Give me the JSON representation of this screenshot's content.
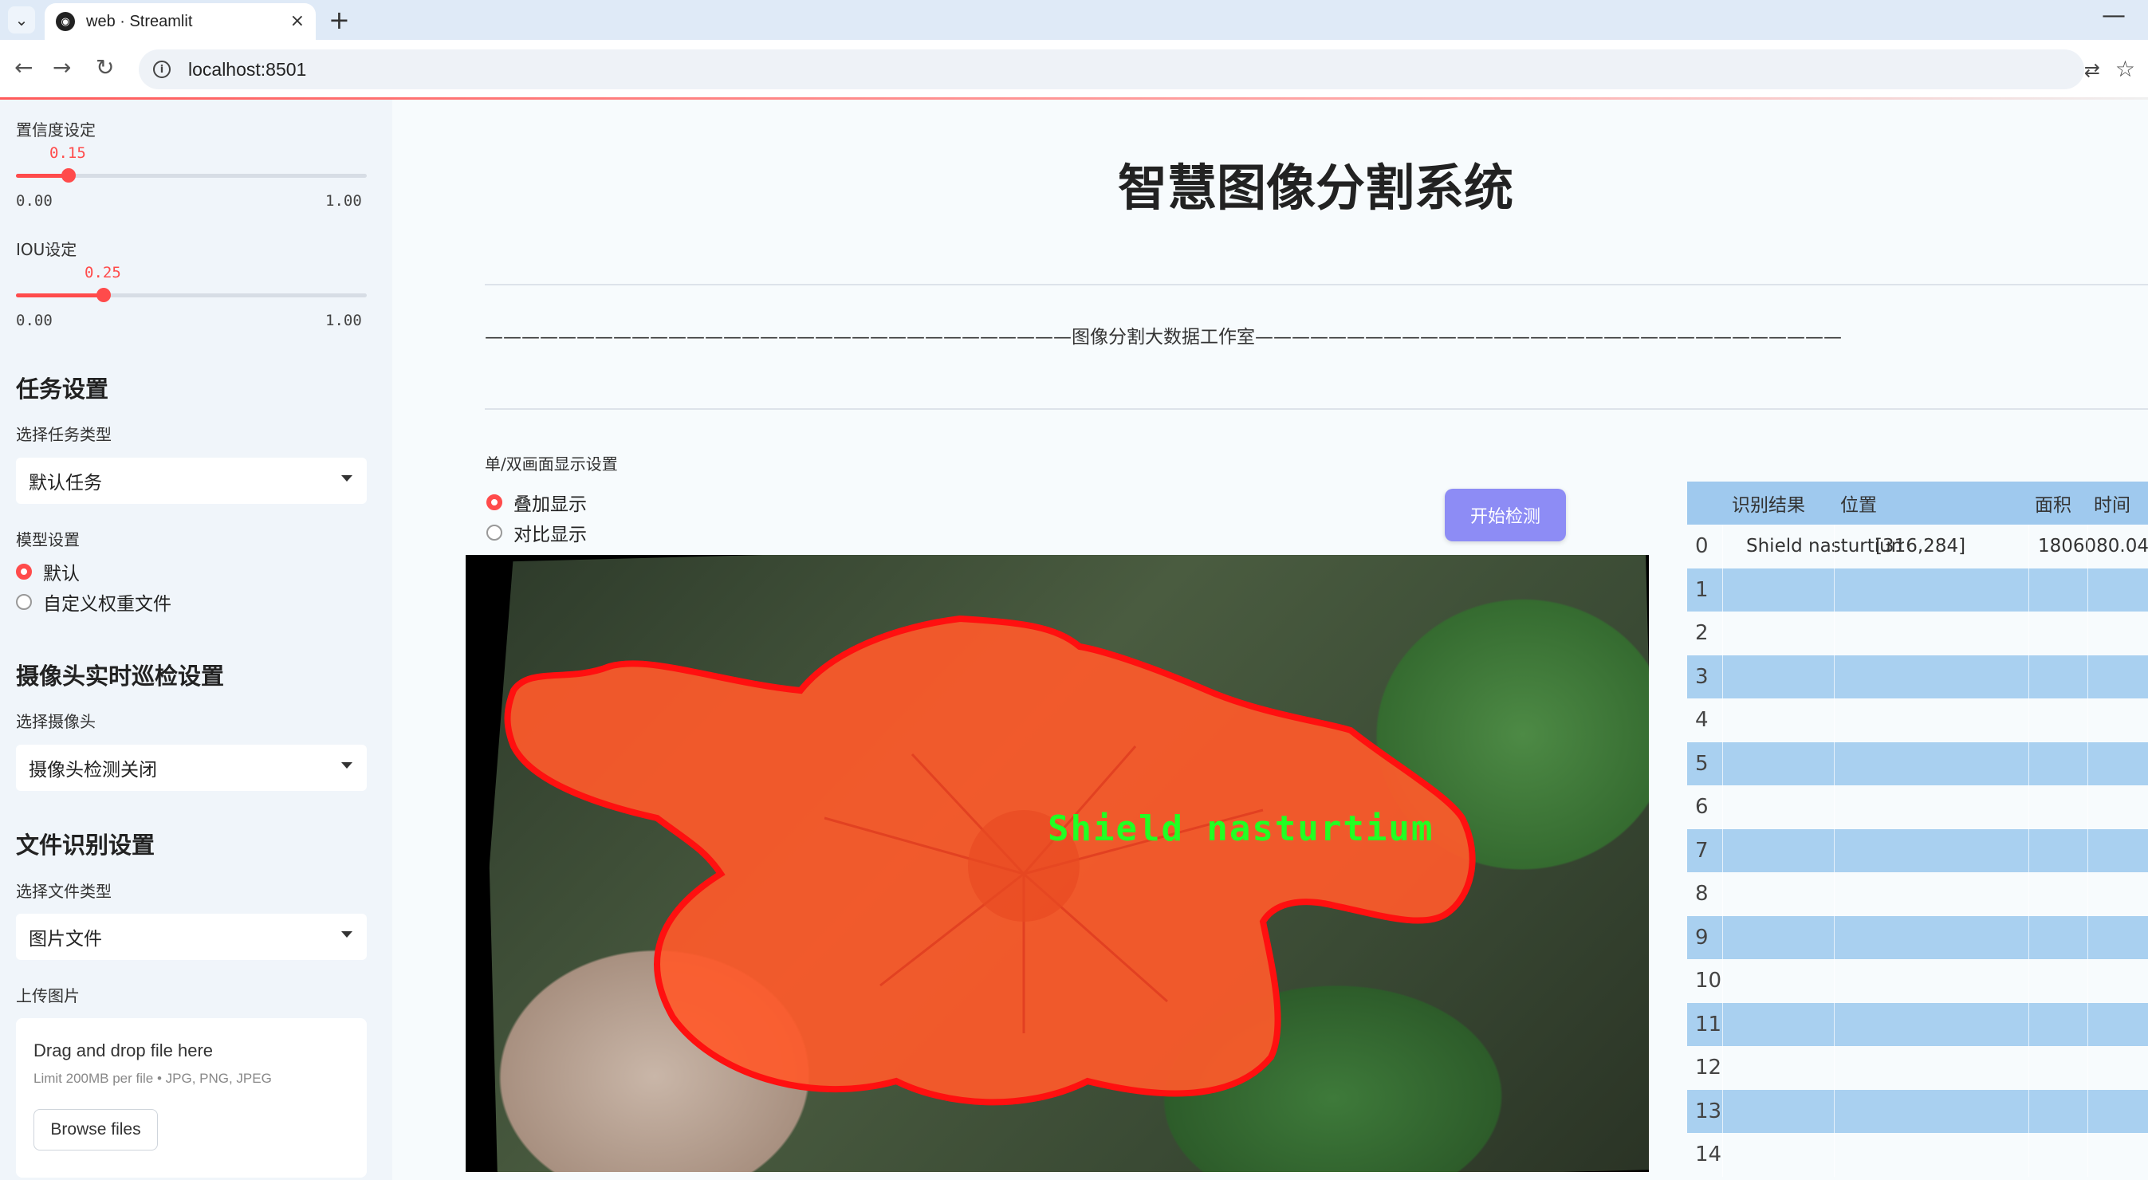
{
  "browser": {
    "tab_title": "web · Streamlit",
    "url": "localhost:8501",
    "tab_close": "×",
    "new_tab": "+",
    "minimize": "—"
  },
  "sidebar": {
    "confidence_label": "置信度设定",
    "confidence_value": "0.15",
    "confidence_fraction": 0.15,
    "iou_label": "IOU设定",
    "iou_value": "0.25",
    "iou_fraction": 0.25,
    "slider_min": "0.00",
    "slider_max": "1.00",
    "task_heading": "任务设置",
    "task_type_label": "选择任务类型",
    "task_type_value": "默认任务",
    "model_label": "模型设置",
    "model_options": [
      "默认",
      "自定义权重文件"
    ],
    "model_selected": "默认",
    "camera_heading": "摄像头实时巡检设置",
    "camera_label": "选择摄像头",
    "camera_value": "摄像头检测关闭",
    "file_heading": "文件识别设置",
    "file_type_label": "选择文件类型",
    "file_type_value": "图片文件",
    "upload_label": "上传图片",
    "upload_title": "Drag and drop file here",
    "upload_sub": "Limit 200MB per file • JPG, PNG, JPEG",
    "browse_label": "Browse files"
  },
  "main": {
    "title": "智慧图像分割系统",
    "banner": "————————————————————————————————图像分割大数据工作室————————————————————————————————",
    "display_label": "单/双画面显示设置",
    "display_options": [
      "叠加显示",
      "对比显示"
    ],
    "display_selected": "叠加显示",
    "start_button": "开始检测",
    "detection_label": "Shield  nasturtium"
  },
  "table": {
    "columns": [
      "识别结果",
      "位置",
      "面积",
      "时间"
    ],
    "rows": [
      {
        "idx": "0",
        "result": "Shield nasturtium",
        "position": "[316,284]",
        "area": "1806080.04",
        "time": ""
      },
      {
        "idx": "1",
        "result": "",
        "position": "",
        "area": "",
        "time": ""
      },
      {
        "idx": "2",
        "result": "",
        "position": "",
        "area": "",
        "time": ""
      },
      {
        "idx": "3",
        "result": "",
        "position": "",
        "area": "",
        "time": ""
      },
      {
        "idx": "4",
        "result": "",
        "position": "",
        "area": "",
        "time": ""
      },
      {
        "idx": "5",
        "result": "",
        "position": "",
        "area": "",
        "time": ""
      },
      {
        "idx": "6",
        "result": "",
        "position": "",
        "area": "",
        "time": ""
      },
      {
        "idx": "7",
        "result": "",
        "position": "",
        "area": "",
        "time": ""
      },
      {
        "idx": "8",
        "result": "",
        "position": "",
        "area": "",
        "time": ""
      },
      {
        "idx": "9",
        "result": "",
        "position": "",
        "area": "",
        "time": ""
      },
      {
        "idx": "10",
        "result": "",
        "position": "",
        "area": "",
        "time": ""
      },
      {
        "idx": "11",
        "result": "",
        "position": "",
        "area": "",
        "time": ""
      },
      {
        "idx": "12",
        "result": "",
        "position": "",
        "area": "",
        "time": ""
      },
      {
        "idx": "13",
        "result": "",
        "position": "",
        "area": "",
        "time": ""
      },
      {
        "idx": "14",
        "result": "",
        "position": "",
        "area": "",
        "time": ""
      }
    ]
  },
  "colors": {
    "accent": "#ff4b4b",
    "button": "#8d8cf5",
    "table_stripe": "#a9d0f0",
    "mask_fill": "#ff5a2a",
    "mask_outline": "#ff1010",
    "label_green": "#22ff22"
  },
  "icons": [
    "chevron-down-icon",
    "streamlit-favicon",
    "close-icon",
    "plus-icon",
    "back-icon",
    "forward-icon",
    "reload-icon",
    "info-icon",
    "translate-icon",
    "star-icon"
  ]
}
